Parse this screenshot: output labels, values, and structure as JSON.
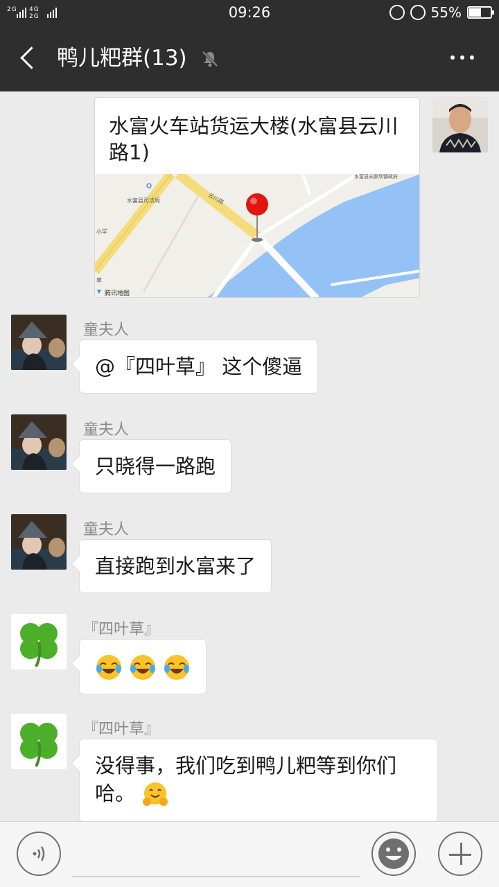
{
  "status_bar": {
    "signal_text": "2G 4G 2G",
    "time": "09:26",
    "battery_percent": "55%",
    "battery_level": 0.55
  },
  "header": {
    "title": "鸭儿粑群(13)"
  },
  "location_message": {
    "title": "水富火车站货运大楼(水富县云川路1)",
    "map_labels": {
      "road": "云川路",
      "court": "水富县司法局",
      "school": "小学",
      "gov": "水富县向家坝镇政府",
      "road2": "云川路",
      "provider": "腾讯地图",
      "grass": "草"
    }
  },
  "messages": [
    {
      "sender": "童夫人",
      "text": "@『四叶草』 这个傻逼"
    },
    {
      "sender": "童夫人",
      "text": "只晓得一路跑"
    },
    {
      "sender": "童夫人",
      "text": "直接跑到水富来了"
    },
    {
      "sender": "『四叶草』",
      "emojis": [
        "laugh-cry",
        "laugh-cry",
        "laugh-cry"
      ]
    },
    {
      "sender": "『四叶草』",
      "text": "没得事，我们吃到鸭儿粑等到你们哈。",
      "trailing_emoji": "hug"
    }
  ],
  "input": {
    "placeholder": ""
  }
}
